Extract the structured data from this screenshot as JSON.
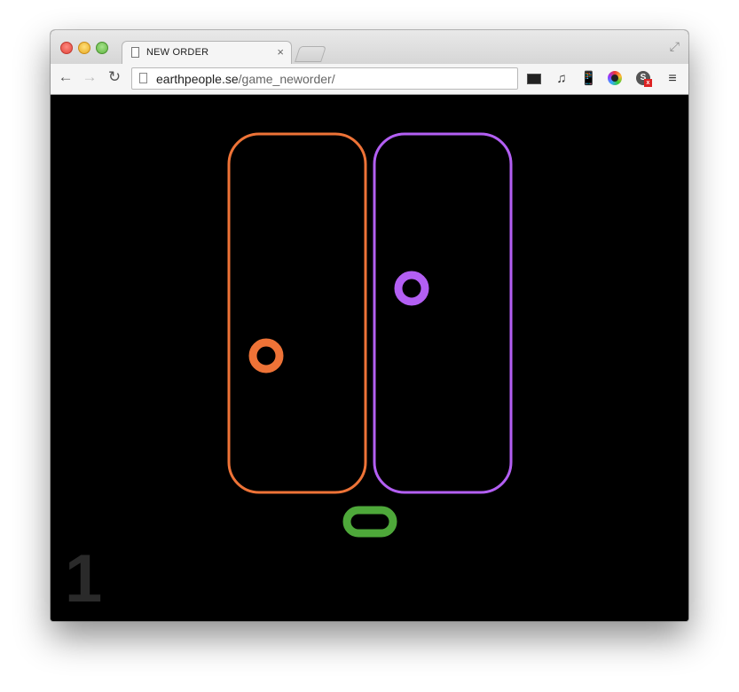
{
  "browser": {
    "tab_title": "NEW ORDER",
    "tab_close": "×",
    "url_host": "earthpeople.se",
    "url_path": "/game_neworder/",
    "icons": {
      "back": "←",
      "forward": "→",
      "reload": "↻",
      "music": "♫",
      "phone": "📱",
      "menu": "≡",
      "fullscreen": "⤢",
      "ext_s": "S",
      "ext_badge": "x"
    }
  },
  "game": {
    "score": "1",
    "colors": {
      "orange": "#ee7337",
      "purple": "#b35ff3",
      "green": "#4ea83a",
      "background": "#000000"
    },
    "lanes": [
      {
        "name": "orange-lane",
        "color": "#ee7337"
      },
      {
        "name": "purple-lane",
        "color": "#b35ff3"
      }
    ],
    "balls": [
      {
        "name": "orange-ball",
        "color": "#ee7337"
      },
      {
        "name": "purple-ball",
        "color": "#b35ff3"
      }
    ],
    "paddle": {
      "name": "green-paddle",
      "color": "#4ea83a"
    }
  }
}
